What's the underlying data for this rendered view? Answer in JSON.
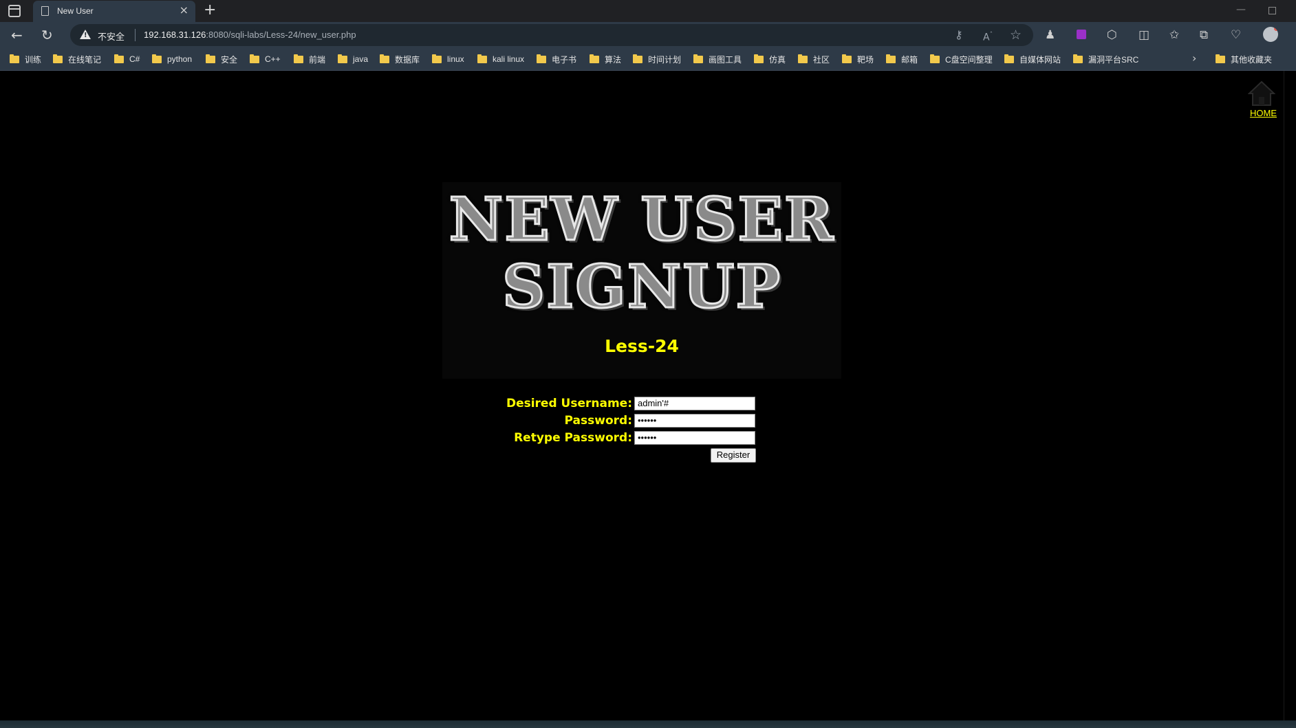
{
  "browser": {
    "tab_title": "New User",
    "new_tab_symbol": "+",
    "close_symbol": "×",
    "insecure_label": "不安全",
    "url_host": "192.168.31.126",
    "url_rest": ":8080/sqli-labs/Less-24/new_user.php",
    "bookmarks": [
      {
        "label": "训练"
      },
      {
        "label": "在线笔记"
      },
      {
        "label": "C#"
      },
      {
        "label": "python"
      },
      {
        "label": "安全"
      },
      {
        "label": "C++"
      },
      {
        "label": "前端"
      },
      {
        "label": "java"
      },
      {
        "label": "数据库"
      },
      {
        "label": "linux"
      },
      {
        "label": "kali linux"
      },
      {
        "label": "电子书"
      },
      {
        "label": "算法"
      },
      {
        "label": "时间计划"
      },
      {
        "label": "画图工具"
      },
      {
        "label": "仿真"
      },
      {
        "label": "社区"
      },
      {
        "label": "靶场"
      },
      {
        "label": "邮箱"
      },
      {
        "label": "C盘空间整理"
      },
      {
        "label": "自媒体网站"
      },
      {
        "label": "漏洞平台SRC"
      }
    ],
    "other_bookmarks": "其他收藏夹"
  },
  "page": {
    "home_link": "HOME",
    "banner_line1": "NEW USER",
    "banner_line2": "SIGNUP",
    "lesson_title": "Less-24",
    "form": {
      "username_label": "Desired Username:",
      "username_value": "admin'#",
      "password_label": "Password:",
      "password_value": "••••••",
      "retype_label": "Retype Password:",
      "retype_value": "••••••",
      "register_label": "Register"
    }
  },
  "colors": {
    "page_background": "#000000",
    "accent_text": "#ffff00",
    "browser_chrome": "#2e3a47"
  },
  "icons": {
    "home": "home-icon",
    "folder": "folder-icon",
    "warning": "warning-icon"
  }
}
